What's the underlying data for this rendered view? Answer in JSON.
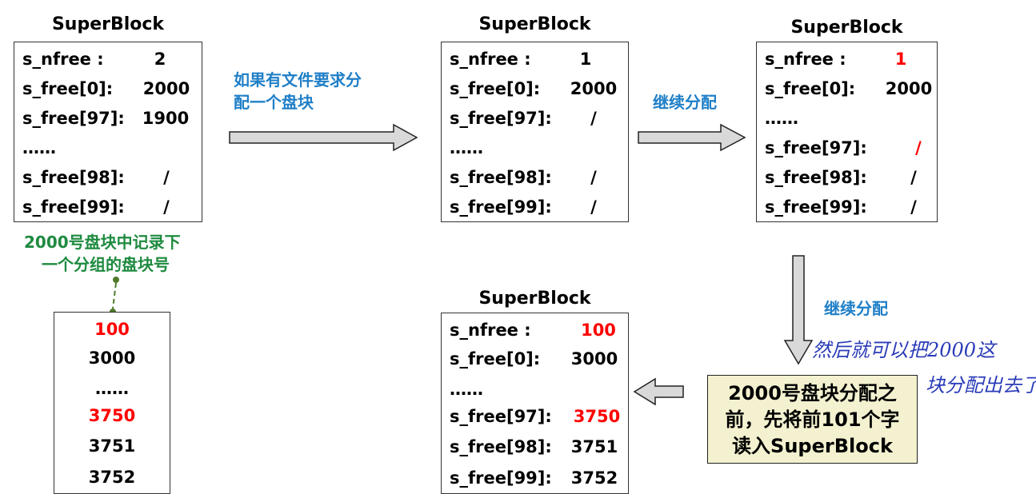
{
  "superblock_title": "SuperBlock",
  "box1": {
    "rows": [
      {
        "label": "s_nfree :",
        "value": "2"
      },
      {
        "label": "s_free[0]:",
        "value": "2000"
      },
      {
        "label": "s_free[97]:",
        "value": "1900"
      },
      {
        "label": "……",
        "value": ""
      },
      {
        "label": "s_free[98]:",
        "value": "/"
      },
      {
        "label": "s_free[99]:",
        "value": "/"
      }
    ]
  },
  "box2": {
    "rows": [
      {
        "label": "s_nfree :",
        "value": "1"
      },
      {
        "label": "s_free[0]:",
        "value": "2000"
      },
      {
        "label": "s_free[97]:",
        "value": "/"
      },
      {
        "label": "……",
        "value": ""
      },
      {
        "label": "s_free[98]:",
        "value": "/"
      },
      {
        "label": "s_free[99]:",
        "value": "/"
      }
    ]
  },
  "box3": {
    "rows": [
      {
        "label": "s_nfree :",
        "value": "1"
      },
      {
        "label": "s_free[0]:",
        "value": "2000"
      },
      {
        "label": "……",
        "value": ""
      },
      {
        "label": "s_free[97]:",
        "value": "/"
      },
      {
        "label": "s_free[98]:",
        "value": "/"
      },
      {
        "label": "s_free[99]:",
        "value": "/"
      }
    ]
  },
  "box4": {
    "rows": [
      {
        "label": "s_nfree :",
        "value": "100"
      },
      {
        "label": "s_free[0]:",
        "value": "3000"
      },
      {
        "label": "……",
        "value": ""
      },
      {
        "label": "s_free[97]:",
        "value": "3750"
      },
      {
        "label": "s_free[98]:",
        "value": "3751"
      },
      {
        "label": "s_free[99]:",
        "value": "3752"
      }
    ]
  },
  "block_list": [
    "100",
    "3000",
    "……",
    "3750",
    "3751",
    "3752"
  ],
  "notes": {
    "request_alloc_line1": "如果有文件要求分",
    "request_alloc_line2": "配一个盘块",
    "continue_alloc_1": "继续分配",
    "continue_alloc_2": "继续分配",
    "green_line1": "2000号盘块中记录下",
    "green_line2": "一个分组的盘块号",
    "yellow_line1": "2000号盘块分配之",
    "yellow_line2": "前，先将前101个字",
    "yellow_line3": "读入SuperBlock",
    "handwriting_line1": "然后就可以把2000这",
    "handwriting_line2": "块分配出去了"
  },
  "colors": {
    "highlight_red": "#ff0000",
    "note_blue": "#1f7fc7",
    "note_green": "#1d8a3f",
    "yellow_fill": "#f3f1cf",
    "arrow_fill": "#d9d9d9",
    "handwriting": "#2a3bb8"
  }
}
